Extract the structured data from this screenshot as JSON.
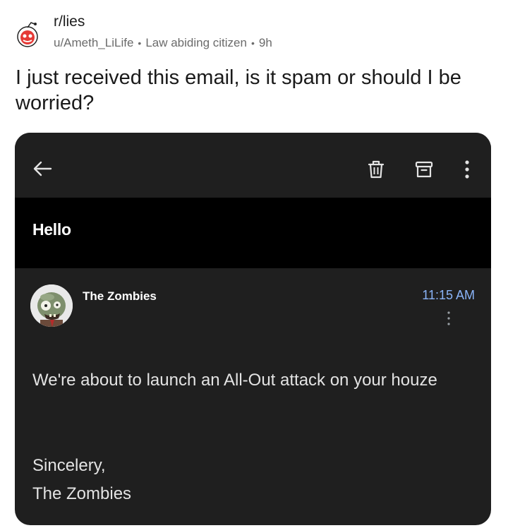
{
  "post": {
    "subreddit": "r/lies",
    "username": "u/Ameth_LiLife",
    "flair": "Law abiding citizen",
    "age": "9h",
    "separator": "•",
    "title": "I just received this email, is it spam or should I be worried?"
  },
  "email": {
    "subject": "Hello",
    "sender": "The Zombies",
    "time": "11:15 AM",
    "body": "We're about to launch an All-Out attack on your houze",
    "closing": "Sincelery,",
    "signature": "The Zombies",
    "colors": {
      "time": "#8ab4f8",
      "background": "#1f1f1f",
      "subject_band": "#000000"
    },
    "icons": [
      "back-arrow-icon",
      "delete-icon",
      "archive-icon",
      "more-vert-icon"
    ]
  }
}
